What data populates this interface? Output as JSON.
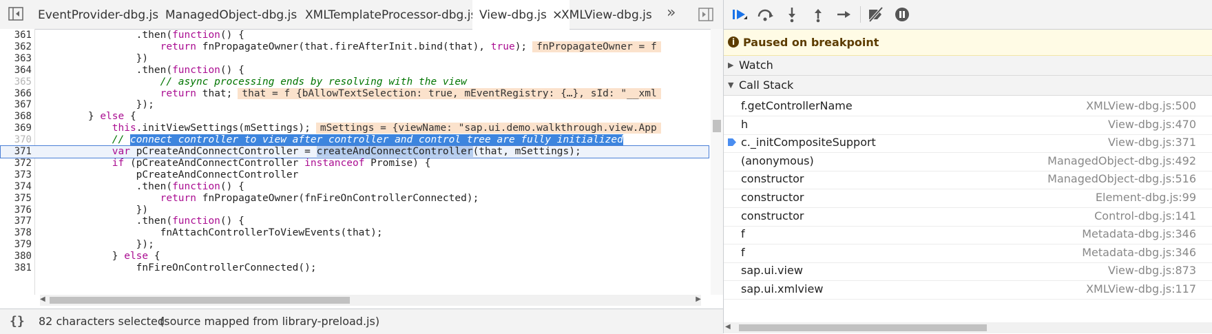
{
  "tabs": [
    {
      "label": "EventProvider-dbg.js"
    },
    {
      "label": "ManagedObject-dbg.js"
    },
    {
      "label": "XMLTemplateProcessor-dbg.js"
    },
    {
      "label": "View-dbg.js",
      "close": "×"
    },
    {
      "label": "XMLView-dbg.js"
    }
  ],
  "tab_more": "»",
  "code_lines": [
    {
      "n": "361",
      "t": "                .then(function() {"
    },
    {
      "n": "362",
      "t": "                    return fnPropagateOwner(that.fireAfterInit.bind(that), true);",
      "inline": "fnPropagateOwner = f"
    },
    {
      "n": "363",
      "t": "                })"
    },
    {
      "n": "364",
      "t": "                .then(function() {"
    },
    {
      "n": "365",
      "t": "                    // async processing ends by resolving with the view"
    },
    {
      "n": "366",
      "t": "                    return that;",
      "inline": "that = f {bAllowTextSelection: true, mEventRegistry: {…}, sId: \"__xml"
    },
    {
      "n": "367",
      "t": "                });"
    },
    {
      "n": "368",
      "t": "        } else {"
    },
    {
      "n": "369",
      "t": "            this.initViewSettings(mSettings);",
      "inline": "mSettings = {viewName: \"sap.ui.demo.walkthrough.view.App"
    },
    {
      "n": "370",
      "t": "            // connect controller to view after controller and control tree are fully initialized"
    },
    {
      "n": "371",
      "t": "            var pCreateAndConnectController = createAndConnectController(that, mSettings);"
    },
    {
      "n": "372",
      "t": "            if (pCreateAndConnectController instanceof Promise) {"
    },
    {
      "n": "373",
      "t": "                pCreateAndConnectController"
    },
    {
      "n": "374",
      "t": "                .then(function() {"
    },
    {
      "n": "375",
      "t": "                    return fnPropagateOwner(fnFireOnControllerConnected);"
    },
    {
      "n": "376",
      "t": "                })"
    },
    {
      "n": "377",
      "t": "                .then(function() {"
    },
    {
      "n": "378",
      "t": "                    fnAttachControllerToViewEvents(that);"
    },
    {
      "n": "379",
      "t": "                });"
    },
    {
      "n": "380",
      "t": "            } else {"
    },
    {
      "n": "381",
      "t": "                fnFireOnControllerConnected();"
    }
  ],
  "status": {
    "braces": "{}",
    "selection": "82 characters selected",
    "mapped": "(source mapped from library-preload.js)"
  },
  "debugger": {
    "paused": "Paused on breakpoint",
    "watch_label": "Watch",
    "callstack_label": "Call Stack",
    "frames": [
      {
        "name": "f.getControllerName",
        "loc": "XMLView-dbg.js:500"
      },
      {
        "name": "h",
        "loc": "View-dbg.js:470"
      },
      {
        "name": "c._initCompositeSupport",
        "loc": "View-dbg.js:371",
        "current": true
      },
      {
        "name": "(anonymous)",
        "loc": "ManagedObject-dbg.js:492"
      },
      {
        "name": "constructor",
        "loc": "ManagedObject-dbg.js:516"
      },
      {
        "name": "constructor",
        "loc": "Element-dbg.js:99"
      },
      {
        "name": "constructor",
        "loc": "Control-dbg.js:141"
      },
      {
        "name": "f",
        "loc": "Metadata-dbg.js:346"
      },
      {
        "name": "f",
        "loc": "Metadata-dbg.js:346"
      },
      {
        "name": "sap.ui.view",
        "loc": "View-dbg.js:873"
      },
      {
        "name": "sap.ui.xmlview",
        "loc": "XMLView-dbg.js:117"
      }
    ]
  },
  "colors": {
    "accent": "#1a73e8",
    "selection": "#3d85de",
    "paused_bg": "#fffbe5"
  }
}
